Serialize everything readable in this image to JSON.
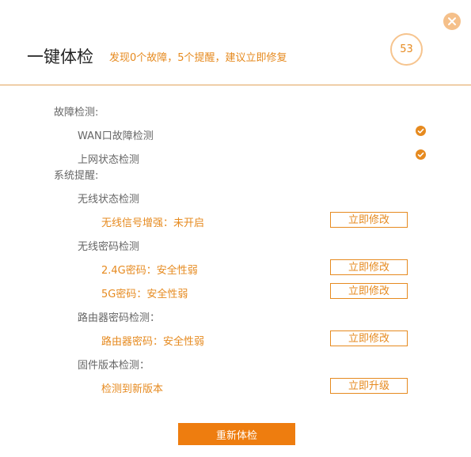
{
  "header": {
    "title": "一键体检",
    "summary": "发现0个故障，5个提醒，建议立即修复",
    "score": "53"
  },
  "icons": {
    "close": "close-icon",
    "check": "check-circle-icon"
  },
  "colors": {
    "accent": "#e68a1f",
    "button_fill": "#ee7d0f",
    "close_bg": "#f5c08a"
  },
  "faults": {
    "heading": "故障检测:",
    "items": [
      {
        "label": "WAN口故障检测",
        "status": "ok"
      },
      {
        "label": "上网状态检测",
        "status": "ok"
      }
    ]
  },
  "reminders": {
    "heading": "系统提醒:",
    "groups": [
      {
        "label": "无线状态检测",
        "issues": [
          {
            "text": "无线信号增强：未开启",
            "action": "立即修改"
          }
        ]
      },
      {
        "label": "无线密码检测",
        "issues": [
          {
            "text": "2.4G密码：安全性弱",
            "action": "立即修改"
          },
          {
            "text": "5G密码：安全性弱",
            "action": "立即修改"
          }
        ]
      },
      {
        "label": "路由器密码检测：",
        "issues": [
          {
            "text": "路由器密码：安全性弱",
            "action": "立即修改"
          }
        ]
      },
      {
        "label": "固件版本检测：",
        "issues": [
          {
            "text": "检测到新版本",
            "action": "立即升级"
          }
        ]
      }
    ]
  },
  "footer": {
    "rescan_label": "重新体检"
  }
}
